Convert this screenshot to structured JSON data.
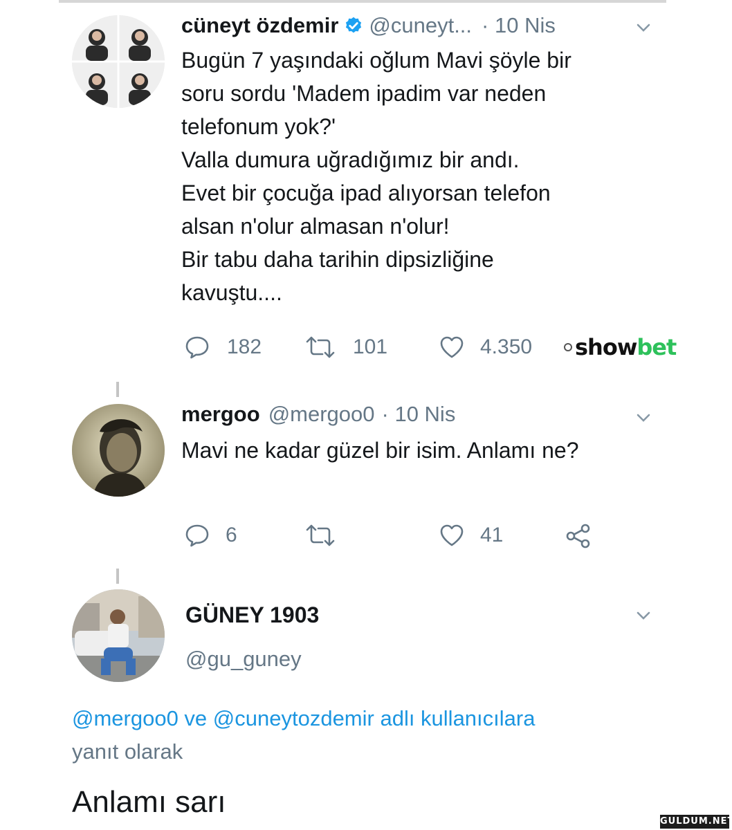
{
  "tweet1": {
    "name": "cüneyt özdemir",
    "handle": "@cuneyt...",
    "date": "· 10 Nis",
    "lines": [
      "Bugün 7 yaşındaki oğlum Mavi şöyle bir",
      "soru sordu 'Madem ipadim var neden",
      "telefonum yok?'",
      "Valla dumura uğradığımız bir andı.",
      "Evet bir çocuğa ipad alıyorsan telefon",
      "alsan n'olur almasan n'olur!",
      "Bir tabu daha tarihin dipsizliğine",
      "kavuştu...."
    ],
    "replies": "182",
    "retweets": "101",
    "likes": "4.350"
  },
  "ad": {
    "show": "show",
    "bet": "bet"
  },
  "tweet2": {
    "name": "mergoo",
    "handle": "@mergoo0",
    "date": "· 10 Nis",
    "text": "Mavi ne kadar güzel bir isim. Anlamı ne?",
    "replies": "6",
    "likes": "41"
  },
  "tweet3": {
    "name": "GÜNEY 1903",
    "handle": "@gu_guney",
    "reply_to_users": "@mergoo0 ve @cuneytozdemir adlı kullanıcılara",
    "reply_to_suffix": "yanıt olarak",
    "text": "Anlamı sarı"
  },
  "watermark": "GULDUM.NET",
  "colors": {
    "link": "#1b95e0",
    "muted": "#657786",
    "verified": "#1da1f2",
    "ad_green": "#2ec15b"
  }
}
